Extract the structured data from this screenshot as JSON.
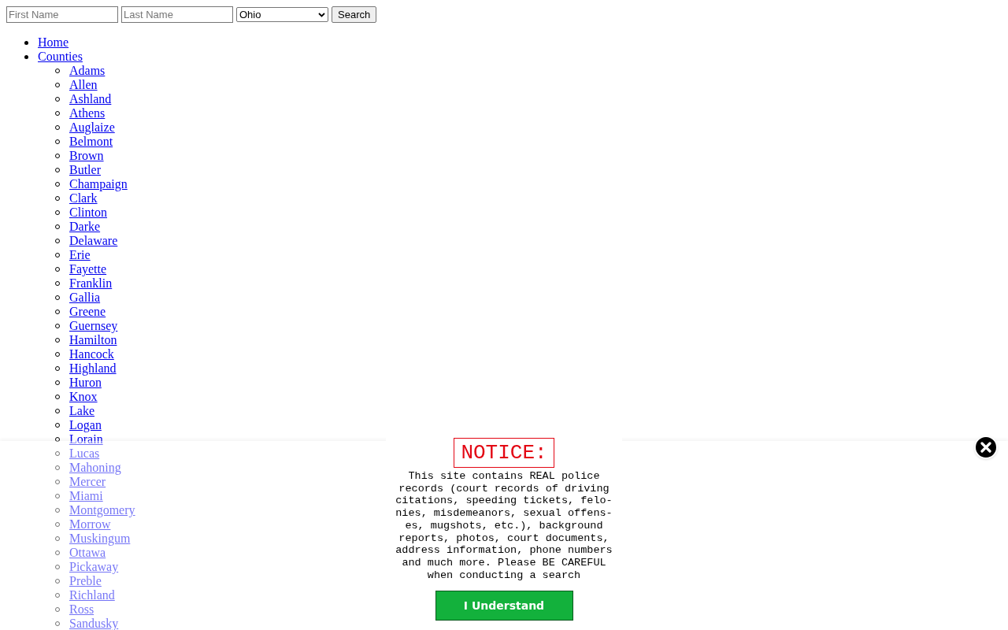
{
  "search_form": {
    "first_name": {
      "placeholder": "First Name"
    },
    "last_name": {
      "placeholder": "Last Name"
    },
    "state": {
      "value": "Ohio"
    },
    "button": "Search"
  },
  "nav": [
    {
      "label": "Home"
    },
    {
      "label": "Counties",
      "children": [
        {
          "label": "Adams"
        },
        {
          "label": "Allen"
        },
        {
          "label": "Ashland"
        },
        {
          "label": "Athens"
        },
        {
          "label": "Auglaize"
        },
        {
          "label": "Belmont"
        },
        {
          "label": "Brown"
        },
        {
          "label": "Butler"
        },
        {
          "label": "Champaign"
        },
        {
          "label": "Clark"
        },
        {
          "label": "Clinton"
        },
        {
          "label": "Darke"
        },
        {
          "label": "Delaware"
        },
        {
          "label": "Erie"
        },
        {
          "label": "Fayette"
        },
        {
          "label": "Franklin"
        },
        {
          "label": "Gallia"
        },
        {
          "label": "Greene"
        },
        {
          "label": "Guernsey"
        },
        {
          "label": "Hamilton"
        },
        {
          "label": "Hancock"
        },
        {
          "label": "Highland"
        },
        {
          "label": "Huron"
        },
        {
          "label": "Knox"
        },
        {
          "label": "Lake"
        },
        {
          "label": "Logan"
        },
        {
          "label": "Lorain"
        },
        {
          "label": "Lucas"
        },
        {
          "label": "Mahoning"
        },
        {
          "label": "Mercer"
        },
        {
          "label": "Miami"
        },
        {
          "label": "Montgomery"
        },
        {
          "label": "Morrow"
        },
        {
          "label": "Muskingum"
        },
        {
          "label": "Ottawa"
        },
        {
          "label": "Pickaway"
        },
        {
          "label": "Preble"
        },
        {
          "label": "Richland"
        },
        {
          "label": "Ross"
        },
        {
          "label": "Sandusky"
        }
      ]
    }
  ],
  "notice": {
    "title": "NOTICE:",
    "body": "This site contains REAL police records (court records of driving citations, speeding tickets, felo-nies, misdemeanors, sexual offens-es, mugshots, etc.), background reports, photos, court documents, address information, phone numbers and much more. Please BE CAREFUL when conducting a search",
    "button": "I Understand"
  }
}
